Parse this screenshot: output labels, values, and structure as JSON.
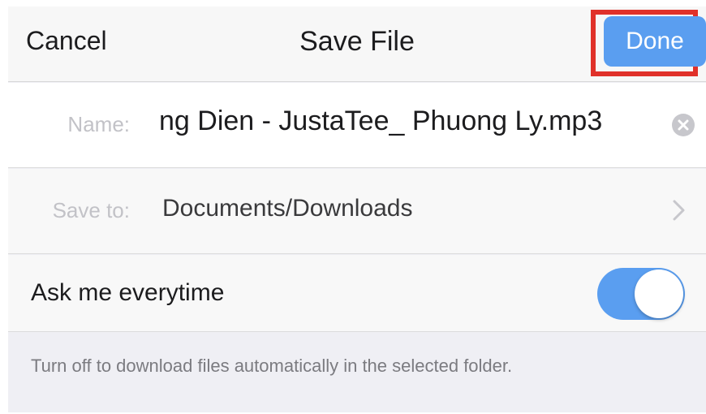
{
  "navbar": {
    "cancel_label": "Cancel",
    "title": "Save File",
    "done_label": "Done"
  },
  "form": {
    "name_label": "Name:",
    "name_value": "ng Dien - JustaTee_ Phuong Ly.mp3",
    "save_to_label": "Save to:",
    "save_to_value": "Documents/Downloads",
    "ask_label": "Ask me everytime",
    "ask_toggle_on": true
  },
  "footer": {
    "note": "Turn off to download files automatically in the selected folder."
  },
  "colors": {
    "accent": "#5a9ef0",
    "highlight": "#e0312a"
  }
}
